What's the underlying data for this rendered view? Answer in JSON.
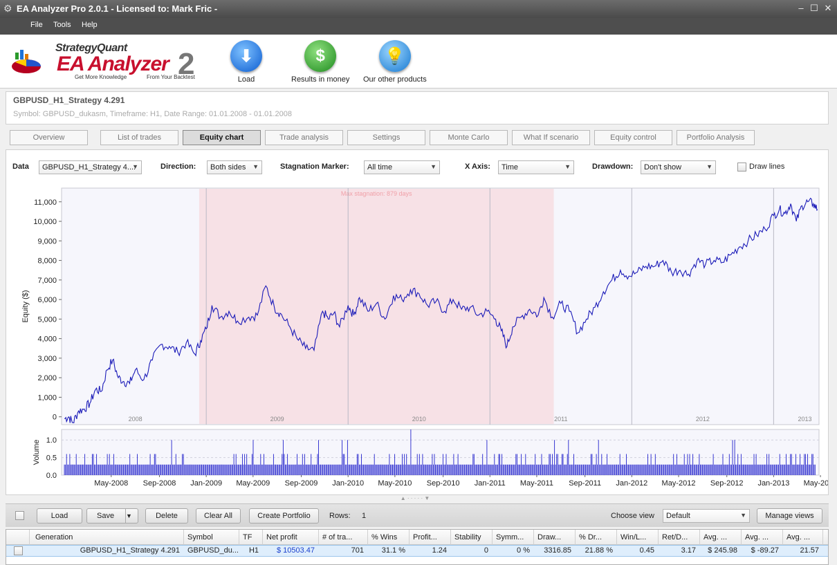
{
  "window": {
    "title": "EA Analyzer Pro 2.0.1 - Licensed to: Mark Fric -",
    "controls": [
      "–",
      "☐",
      "✕"
    ]
  },
  "menu": [
    "File",
    "Tools",
    "Help"
  ],
  "logo": {
    "brand": "StrategyQuant",
    "product": "EA Analyzer",
    "version": "2",
    "tagline_left": "Get More Knowledge",
    "tagline_right": "From Your Backtest"
  },
  "toolbar": {
    "load": "Load",
    "results": "Results in money",
    "products": "Our other products"
  },
  "strategy": {
    "name": "GBPUSD_H1_Strategy 4.291",
    "description": "Symbol: GBPUSD_dukasm, Timeframe: H1, Date Range: 01.01.2008 - 01.01.2008"
  },
  "tabs": [
    "Overview",
    "List of trades",
    "Equity chart",
    "Trade analysis",
    "Settings",
    "Monte Carlo",
    "What If scenario",
    "Equity control",
    "Portfolio Analysis"
  ],
  "active_tab": "Equity chart",
  "controls": {
    "data_label": "Data",
    "data_value": "GBPUSD_H1_Strategy 4....",
    "direction_label": "Direction:",
    "direction_value": "Both sides",
    "stagnation_label": "Stagnation Marker:",
    "stagnation_value": "All time",
    "xaxis_label": "X Axis:",
    "xaxis_value": "Time",
    "drawdown_label": "Drawdown:",
    "drawdown_value": "Don't show",
    "draw_lines_label": "Draw lines",
    "draw_lines_checked": false
  },
  "chart_data": [
    {
      "type": "line",
      "ylabel": "Equity ($)",
      "xlabel": "",
      "annotation": "Max stagnation: 879 days",
      "stagnation_range": [
        2008.95,
        2011.45
      ],
      "ylim": [
        -400,
        11700
      ],
      "xlim": [
        2007.98,
        2013.32
      ],
      "y_ticks": [
        0,
        1000,
        2000,
        3000,
        4000,
        5000,
        6000,
        7000,
        8000,
        9000,
        10000,
        11000
      ],
      "y_tick_labels": [
        "0",
        "1,000",
        "2,000",
        "3,000",
        "4,000",
        "5,000",
        "6,000",
        "7,000",
        "8,000",
        "9,000",
        "10,000",
        "11,000"
      ],
      "year_labels": [
        "2008",
        "2009",
        "2010",
        "2011",
        "2012",
        "2013"
      ],
      "year_label_x": [
        2008.5,
        2009.5,
        2010.5,
        2011.5,
        2012.5,
        2013.22
      ],
      "year_separators": [
        2009.0,
        2010.0,
        2011.0,
        2012.0,
        2013.0
      ],
      "colors": {
        "line": "#1a1ab8",
        "stagnation": "#f7e1e6",
        "annotation": "#f0a0a8"
      },
      "series": [
        {
          "x": [
            2008.0,
            2008.03,
            2008.06,
            2008.1,
            2008.14,
            2008.18,
            2008.22,
            2008.26,
            2008.3,
            2008.34,
            2008.38,
            2008.42,
            2008.46,
            2008.5,
            2008.56,
            2008.62,
            2008.68,
            2008.74,
            2008.8,
            2008.86,
            2008.92,
            2008.96,
            2009.0,
            2009.04,
            2009.1,
            2009.16,
            2009.22,
            2009.3,
            2009.36,
            2009.42,
            2009.48,
            2009.52,
            2009.58,
            2009.64,
            2009.7,
            2009.76,
            2009.82,
            2009.86,
            2009.9,
            2009.94,
            2010.0,
            2010.04,
            2010.08,
            2010.14,
            2010.2,
            2010.26,
            2010.32,
            2010.38,
            2010.44,
            2010.5,
            2010.56,
            2010.62,
            2010.68,
            2010.74,
            2010.8,
            2010.86,
            2010.92,
            2010.98,
            2011.04,
            2011.08,
            2011.12,
            2011.16,
            2011.22,
            2011.28,
            2011.34,
            2011.38,
            2011.44,
            2011.5,
            2011.56,
            2011.62,
            2011.68,
            2011.74,
            2011.8,
            2011.86,
            2011.92,
            2011.98,
            2012.04,
            2012.1,
            2012.16,
            2012.22,
            2012.28,
            2012.34,
            2012.4,
            2012.46,
            2012.52,
            2012.58,
            2012.64,
            2012.7,
            2012.76,
            2012.82,
            2012.88,
            2012.94,
            2013.0,
            2013.04,
            2013.08,
            2013.12,
            2013.16,
            2013.2,
            2013.24,
            2013.28,
            2013.31
          ],
          "y": [
            -100,
            0,
            -300,
            300,
            400,
            700,
            1400,
            1300,
            2400,
            2900,
            2000,
            1800,
            1700,
            2400,
            1900,
            2900,
            3700,
            3600,
            3300,
            3800,
            3200,
            3900,
            4500,
            5700,
            5100,
            5400,
            4900,
            5100,
            5200,
            6700,
            5600,
            5300,
            4700,
            4000,
            3500,
            3400,
            5400,
            5000,
            5300,
            4600,
            5700,
            5200,
            6100,
            5400,
            5800,
            5000,
            6200,
            6000,
            6500,
            6300,
            5700,
            5900,
            5400,
            6000,
            5500,
            5600,
            5200,
            5400,
            5000,
            4400,
            3600,
            4600,
            5100,
            5500,
            5200,
            6100,
            5100,
            5800,
            5400,
            4300,
            5000,
            5600,
            6400,
            7000,
            7500,
            7200,
            7400,
            7700,
            7700,
            8000,
            7400,
            7500,
            7300,
            8000,
            7800,
            8000,
            7900,
            8300,
            8700,
            9000,
            9300,
            9600,
            10300,
            10600,
            10400,
            10900,
            10000,
            10800,
            11000,
            10900,
            10600
          ]
        }
      ]
    },
    {
      "type": "bar",
      "ylabel": "Volume",
      "ylim": [
        0,
        1.3
      ],
      "y_ticks": [
        0,
        0.5,
        1.0
      ],
      "y_tick_labels": [
        "0.0",
        "0.5",
        "1.0"
      ],
      "x_tick_labels": [
        "May-2008",
        "Sep-2008",
        "Jan-2009",
        "May-2009",
        "Sep-2009",
        "Jan-2010",
        "May-2010",
        "Sep-2010",
        "Jan-2011",
        "May-2011",
        "Sep-2011",
        "Jan-2012",
        "May-2012",
        "Sep-2012",
        "Jan-2013",
        "May-2013"
      ],
      "x_tick_values": [
        2008.33,
        2008.67,
        2009.0,
        2009.33,
        2009.67,
        2010.0,
        2010.33,
        2010.67,
        2011.0,
        2011.33,
        2011.67,
        2012.0,
        2012.33,
        2012.67,
        2013.0,
        2013.33
      ],
      "trade_count": 701,
      "typical_volume": 0.3,
      "colors": {
        "bar": "#2222cc"
      }
    }
  ],
  "bottom_toolbar": {
    "load": "Load",
    "save": "Save",
    "delete": "Delete",
    "clear_all": "Clear All",
    "create_portfolio": "Create Portfolio",
    "rows_label": "Rows:",
    "rows_value": "1",
    "choose_view_label": "Choose view",
    "choose_view_value": "Default",
    "manage_views": "Manage views"
  },
  "results_table": {
    "columns": [
      "Generation",
      "Symbol",
      "TF",
      "Net profit",
      "# of tra...",
      "% Wins",
      "Profit...",
      "Stability",
      "Symm...",
      "Draw...",
      "% Dr...",
      "Win/L...",
      "Ret/D...",
      "Avg. ...",
      "Avg. ...",
      "Avg. ..."
    ],
    "rows": [
      [
        "GBPUSD_H1_Strategy 4.291",
        "GBPUSD_du...",
        "H1",
        "$ 10503.47",
        "701",
        "31.1 %",
        "1.24",
        "0",
        "0 %",
        "3316.85",
        "21.88 %",
        "0.45",
        "3.17",
        "$ 245.98",
        "$ -89.27",
        "21.57"
      ]
    ]
  }
}
